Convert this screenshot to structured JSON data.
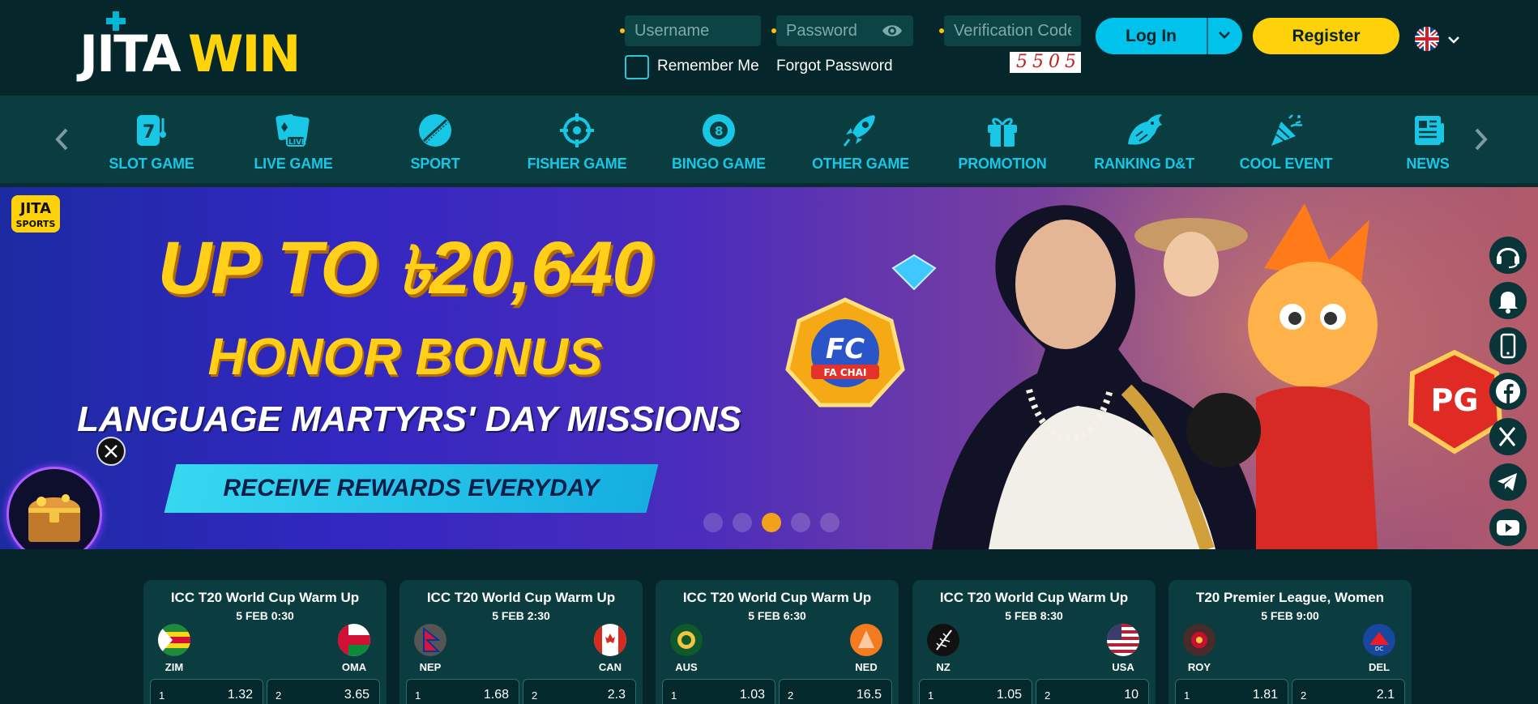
{
  "brand": {
    "part1": "JITA",
    "part2": "WIN"
  },
  "login": {
    "username_placeholder": "Username",
    "password_placeholder": "Password",
    "verification_placeholder": "Verification Code",
    "captcha_text": "5505",
    "remember_label": "Remember Me",
    "forgot_label": "Forgot Password",
    "login_label": "Log In",
    "register_label": "Register"
  },
  "language": {
    "icon": "uk-flag-icon"
  },
  "nav": {
    "items": [
      {
        "label": "SLOT GAME",
        "icon": "slot-machine-icon"
      },
      {
        "label": "LIVE GAME",
        "icon": "live-cards-icon"
      },
      {
        "label": "SPORT",
        "icon": "cricket-ball-icon"
      },
      {
        "label": "FISHER GAME",
        "icon": "crosshair-icon"
      },
      {
        "label": "BINGO GAME",
        "icon": "bingo-ball-icon"
      },
      {
        "label": "OTHER GAME",
        "icon": "rocket-icon"
      },
      {
        "label": "PROMOTION",
        "icon": "gift-icon"
      },
      {
        "label": "RANKING D&T",
        "icon": "dragon-tiger-icon"
      },
      {
        "label": "COOL EVENT",
        "icon": "party-popper-icon"
      },
      {
        "label": "NEWS",
        "icon": "newspaper-icon"
      }
    ]
  },
  "banner": {
    "badge_top": "JITA",
    "badge_bottom": "SPORTS",
    "currency": "৳",
    "line1_prefix": "UP TO",
    "amount": "20,640",
    "line2": "HONOR BONUS",
    "line3": "LANGUAGE MARTYRS' DAY MISSIONS",
    "cta": "RECEIVE REWARDS EVERYDAY",
    "fc_badge_top": "FC",
    "fc_badge_bottom": "FA CHAI",
    "pg_badge": "PG",
    "active_slide_index": 3,
    "slide_count": 5
  },
  "side_buttons": [
    "headset-icon",
    "bell-icon",
    "mobile-icon",
    "facebook-icon",
    "x-icon",
    "telegram-icon",
    "youtube-icon",
    "instagram-icon"
  ],
  "matches": [
    {
      "competition": "ICC T20 World Cup Warm Up",
      "time": "5 FEB 0:30",
      "home": "ZIM",
      "away": "OMA",
      "odd1": "1.32",
      "odd2": "3.65"
    },
    {
      "competition": "ICC T20 World Cup Warm Up",
      "time": "5 FEB 2:30",
      "home": "NEP",
      "away": "CAN",
      "odd1": "1.68",
      "odd2": "2.3"
    },
    {
      "competition": "ICC T20 World Cup Warm Up",
      "time": "5 FEB 6:30",
      "home": "AUS",
      "away": "NED",
      "odd1": "1.03",
      "odd2": "16.5"
    },
    {
      "competition": "ICC T20 World Cup Warm Up",
      "time": "5 FEB 8:30",
      "home": "NZ",
      "away": "USA",
      "odd1": "1.05",
      "odd2": "10"
    },
    {
      "competition": "T20 Premier League, Women",
      "time": "5 FEB 9:00",
      "home": "ROY",
      "away": "DEL",
      "odd1": "1.81",
      "odd2": "2.1"
    }
  ],
  "odd_labels": {
    "one": "1",
    "two": "2"
  },
  "colors": {
    "accent": "#18c6e6",
    "brand_yellow": "#ffd10a",
    "bg": "#06252a"
  }
}
